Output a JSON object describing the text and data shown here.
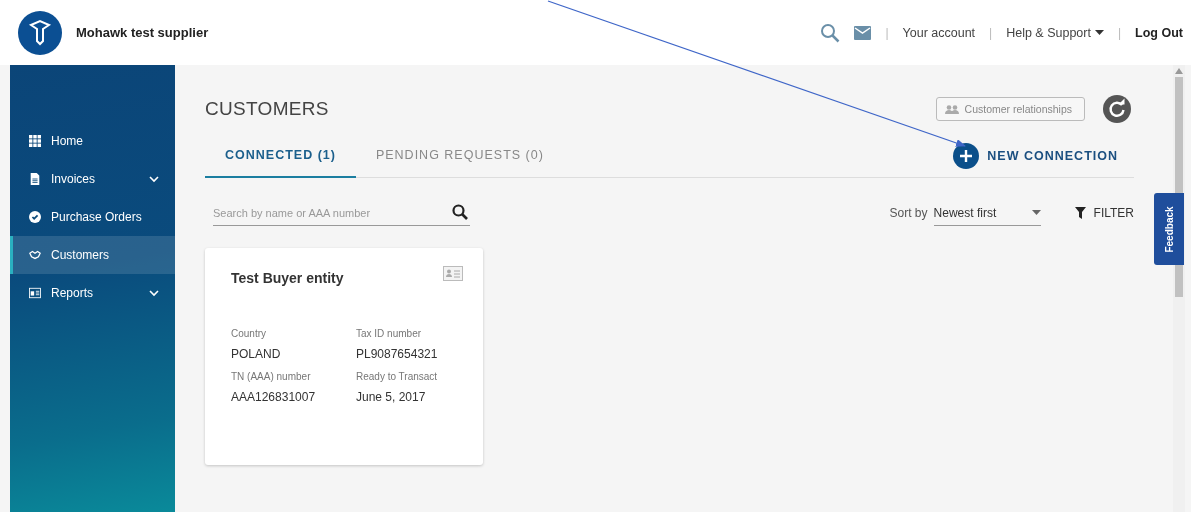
{
  "header": {
    "company": "Mohawk test supplier",
    "links": [
      {
        "separator": "|",
        "label": "Your account",
        "kind": "link"
      },
      {
        "separator": "|",
        "label": "Help & Support",
        "kind": "dropdown"
      }
    ],
    "logout_separator": "|",
    "logout": "Log Out"
  },
  "sidebar": {
    "items": [
      {
        "label": "Home",
        "submenu": false,
        "selected": false
      },
      {
        "label": "Invoices",
        "submenu": true,
        "selected": false
      },
      {
        "label": "Purchase Orders",
        "submenu": false,
        "selected": false
      },
      {
        "label": "Customers",
        "submenu": false,
        "selected": true
      },
      {
        "label": "Reports",
        "submenu": true,
        "selected": false
      }
    ]
  },
  "page": {
    "title": "CUSTOMERS",
    "relationships_button": "Customer relationships",
    "new_connection": "NEW CONNECTION",
    "tabs": [
      {
        "label": "CONNECTED (1)",
        "selected": true
      },
      {
        "label": "PENDING REQUESTS (0)",
        "selected": false
      }
    ],
    "search": {
      "placeholder": "Search by name or AAA number"
    },
    "sort": {
      "label": "Sort by",
      "value": "Newest first"
    },
    "filter": "FILTER",
    "cards": [
      {
        "title": "Test Buyer entity",
        "fields": [
          {
            "label": "Country",
            "value": "POLAND"
          },
          {
            "label": "Tax ID number",
            "value": "PL9087654321"
          },
          {
            "label": "TN (AAA) number",
            "value": "AAA126831007"
          },
          {
            "label": "Ready to Transact",
            "value": "June 5, 2017"
          }
        ]
      }
    ]
  },
  "feedback": "Feedback"
}
